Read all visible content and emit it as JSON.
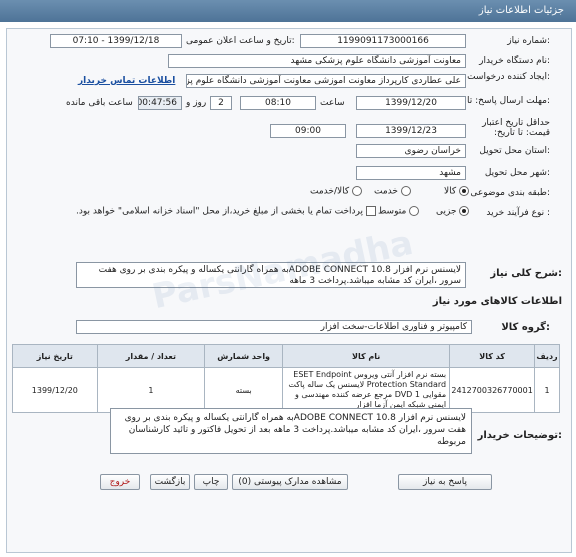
{
  "header": {
    "title": "جزئیات اطلاعات نیاز"
  },
  "fields": {
    "need_number_label": "شماره نیاز:",
    "need_number": "1199091173000166",
    "announce_label": "تاریخ و ساعت اعلان عمومی:",
    "announce_value": "1399/12/18 - 07:10",
    "buyer_label": "نام دستگاه خریدار:",
    "buyer_value": "معاونت آموزشی دانشگاه علوم پزشکی مشهد",
    "creator_label": "ایجاد کننده درخواست:",
    "creator_value": "علی عطاردی کارپرداز معاونت اموزشی معاونت آموزشی دانشگاه علوم پزشکی م",
    "contact_link": "اطلاعات تماس خریدار",
    "deadline_label": "مهلت ارسال پاسخ: تا تاریخ:",
    "deadline_date": "1399/12/20",
    "time_label": "ساعت",
    "deadline_time": "08:10",
    "days_value": "2",
    "days_label": "روز و",
    "remaining_time": "00:47:56",
    "remaining_label": "ساعت باقی مانده",
    "validity_label": "حداقل تاریخ اعتبار قیمت: تا تاریخ:",
    "validity_date": "1399/12/23",
    "validity_time": "09:00",
    "province_label": "استان محل تحویل:",
    "province_value": "خراسان رضوی",
    "city_label": "شهر محل تحویل:",
    "city_value": "مشهد",
    "category_label": "طبقه بندی موضوعی:",
    "category_options": [
      "کالا",
      "خدمت",
      "کالا/خدمت"
    ],
    "process_label": "نوع فرآیند خرید :",
    "process_options": [
      "جزیی",
      "متوسط"
    ],
    "payment_note": "پرداخت تمام یا بخشی از مبلغ خرید،از محل \"اسناد خزانه اسلامی\" خواهد بود."
  },
  "summary": {
    "label": "شرح کلی نیاز:",
    "text": "لایسنس نرم افزار ADOBE CONNECT 10.8به همراه گارانتی یکساله و پیکره بندی بر روی هفت سرور ،ایران کد مشابه میباشد.پرداخت 3 ماهه"
  },
  "goods": {
    "section_title": "اطلاعات کالاهای مورد نیاز",
    "group_label": "گروه کالا:",
    "group_value": "کامپیوتر و فناوری اطلاعات-سخت افزار",
    "headers": [
      "ردیف",
      "کد کالا",
      "نام کالا",
      "واحد شمارش",
      "تعداد / مقدار",
      "تاریخ نیاز"
    ],
    "rows": [
      {
        "row": "1",
        "code": "2412700326770001",
        "name": "بسته نرم افزار آنتی ویروس ESET Endpoint Protection Standard لایسنس یک ساله پاکت مقوایی DVD 1 مرجع عرضه کننده مهندسی و ایمنی شبکه ایمن آزما افزار",
        "unit": "بسته",
        "qty": "1",
        "date": "1399/12/20"
      }
    ]
  },
  "buyer_notes": {
    "label": "توضیحات خریدار:",
    "text": "لایسنس نرم افزار ADOBE CONNECT 10.8به همراه گارانتی یکساله و پیکره بندی بر روی هفت سرور ،ایران کد مشابه میباشد.پرداخت 3 ماهه بعد از تحویل فاکتور و تائید کارشناسان مربوطه"
  },
  "buttons": {
    "reply": "پاسخ به نیاز",
    "attachments": "مشاهده مدارک پیوستی (0)",
    "print": "چاپ",
    "back": "بازگشت",
    "exit": "خروج"
  },
  "colors": {
    "header": "#5b7fa3",
    "link": "#1a4fa0",
    "exit_text": "#b01818"
  }
}
